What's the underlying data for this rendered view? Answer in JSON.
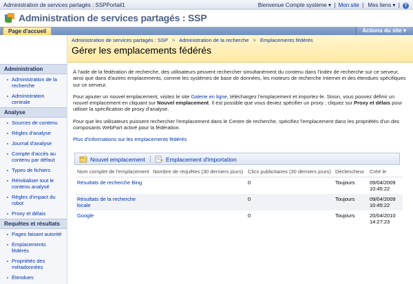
{
  "topbar": {
    "breadcrumb": "Administration de services partagés : SSPPortail1",
    "welcome": "Bienvenue Compte système",
    "my_site": "Mon site",
    "my_links": "Mes liens"
  },
  "header": {
    "title": "Administration de services partagés : SSP"
  },
  "nav": {
    "home_tab": "Page d'accueil",
    "site_actions": "Actions du site"
  },
  "sidebar": {
    "sections": [
      {
        "title": "Administration",
        "items": [
          "Administration de la recherche",
          "Administration centrale"
        ]
      },
      {
        "title": "Analyse",
        "items": [
          "Sources de contenu",
          "Règles d'analyse",
          "Journal d'analyse",
          "Compte d'accès au contenu par défaut",
          "Types de fichiers",
          "Réinitialiser tout le contenu analysé",
          "Règles d'impact du robot",
          "Proxy et délais"
        ]
      },
      {
        "title": "Requêtes et résultats",
        "items": [
          "Pages faisant autorité",
          "Emplacements fédérés",
          "Propriétés des métadonnées",
          "Étendues"
        ]
      }
    ]
  },
  "breadcrumb": {
    "items": [
      "Administration de services partagés : SSP",
      "Administration de la recherche",
      "Emplacements fédérés"
    ],
    "separator": ">"
  },
  "page_title": "Gérer les emplacements fédérés",
  "intro": {
    "p1": "À l'aide de la fédération de recherche, des utilisateurs peuvent rechercher simultanément du contenu dans l'index de recherche sur ce serveur, ainsi que dans d'autres emplacements, comme les systèmes de base de données, les moteurs de recherche Internet et des étendues spécifiques sur ce serveur.",
    "p2_a": "Pour ajouter un nouvel emplacement, visitez le site ",
    "p2_link": "Galerie en ligne",
    "p2_b": ", téléchargez l'emplacement et importez-le. Sinon, vous pouvez définir un nouvel emplacement en cliquant sur ",
    "p2_bold1": "Nouvel emplacement",
    "p2_c": ". Il est possible que vous deviez spécifier un proxy ; cliquez sur ",
    "p2_bold2": "Proxy et délais",
    "p2_d": " pour utiliser la spécification de proxy d'analyse.",
    "p3": "Pour que les utilisateurs puissent rechercher l'emplacement dans le Centre de recherche, spécifiez l'emplacement dans les propriétés d'un des composants WebPart activé pour la fédération.",
    "more_link": "Plus d'informations sur les emplacements fédérés"
  },
  "toolbar": {
    "new_location": "Nouvel emplacement",
    "import_location": "Emplacement d'importation"
  },
  "table": {
    "columns": [
      "Nom complet de l'emplacement",
      "Nombre de requêtes (30 derniers jours)",
      "Clics publicitaires (30 derniers jours)",
      "Déclencheur",
      "Créé le"
    ],
    "rows": [
      {
        "name": "Résultats de recherche Bing",
        "queries": "",
        "clicks": "0",
        "trigger": "Toujours",
        "created": "09/04/2009 10:45:22"
      },
      {
        "name": "Résultats de la recherche locale",
        "queries": "",
        "clicks": "0",
        "trigger": "Toujours",
        "created": "09/04/2009 10:45:22"
      },
      {
        "name": "Google",
        "queries": "",
        "clicks": "0",
        "trigger": "Toujours",
        "created": "20/04/2010 14:27:23"
      }
    ]
  },
  "colors": {
    "link": "#0033aa",
    "nav_bar": "#7f9bc8",
    "title_band": "#ffe9a5"
  }
}
